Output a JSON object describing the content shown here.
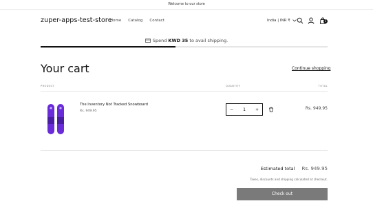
{
  "announcement": "Welcome to our store",
  "header": {
    "logo": "zuper-apps-test-store",
    "nav": [
      "Home",
      "Catalog",
      "Contact"
    ],
    "country": "India | INR ₹",
    "cart_count": "1"
  },
  "shipping": {
    "prefix": "Spend",
    "amount": "KWD 35",
    "suffix": "to avail shipping.",
    "progress_percent": 47
  },
  "cart": {
    "title": "Your cart",
    "continue_link": "Continue shopping",
    "columns": {
      "product": "PRODUCT",
      "quantity": "QUANTITY",
      "total": "TOTAL"
    },
    "items": [
      {
        "name": "The Inventory Not Tracked Snowboard",
        "price": "Rs. 949.95",
        "quantity": "1",
        "line_total": "Rs. 949.95"
      }
    ],
    "qty_minus": "−",
    "qty_plus": "+"
  },
  "summary": {
    "estimated_label": "Estimated total",
    "estimated_value": "Rs. 949.95",
    "taxes_note": "Taxes, discounts and shipping calculated at checkout.",
    "checkout_label": "Check out"
  },
  "colors": {
    "accent": "#121212",
    "checkout_bg": "#7a7a7a",
    "snowboard": "#6a2bd9"
  }
}
